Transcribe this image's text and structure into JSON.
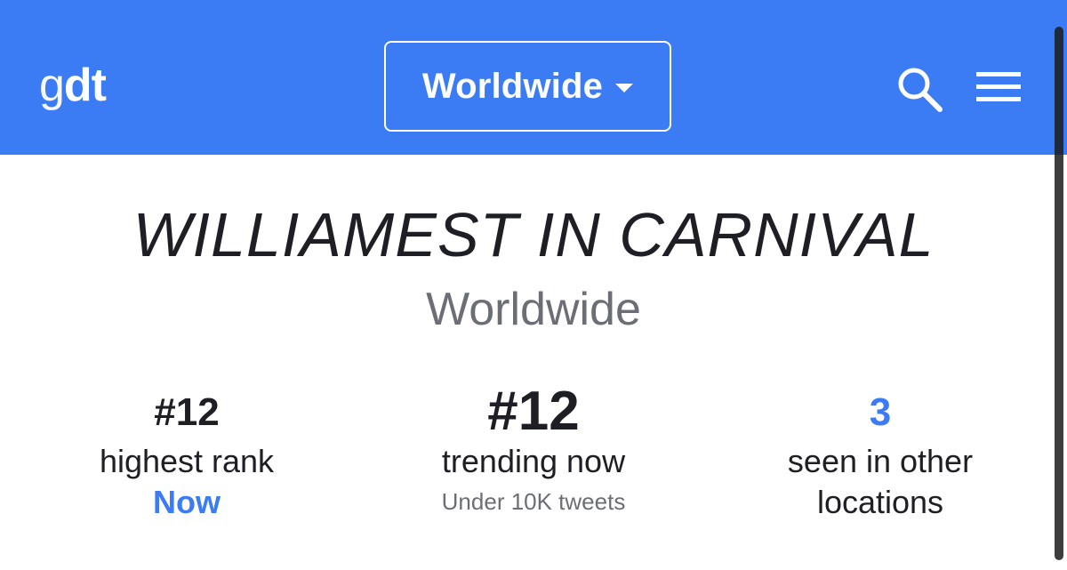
{
  "header": {
    "logo_light": "g",
    "logo_bold": "dt",
    "location": "Worldwide",
    "search_icon": "search-icon",
    "menu_icon": "menu-icon"
  },
  "trend": {
    "title": "WILLIAMEST IN CARNIVAL",
    "location": "Worldwide"
  },
  "stats": {
    "highest": {
      "value": "#12",
      "label": "highest rank",
      "sub": "Now"
    },
    "current": {
      "value": "#12",
      "label": "trending now",
      "sub": "Under 10K tweets"
    },
    "other": {
      "value": "3",
      "label_line1": "seen in other",
      "label_line2": "locations"
    }
  },
  "colors": {
    "brand": "#3b7cf5",
    "accent": "#3b7cf5",
    "text": "#1e1f24",
    "muted": "#6b6f75"
  }
}
